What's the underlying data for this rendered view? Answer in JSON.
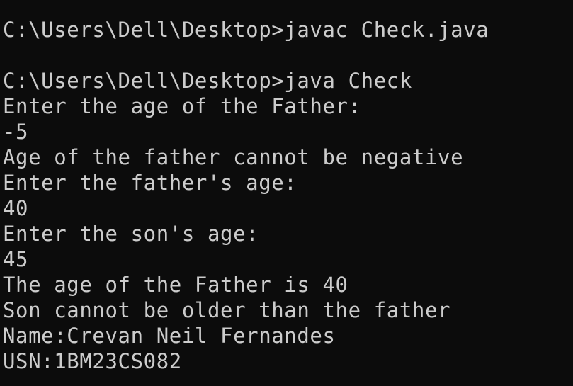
{
  "terminal": {
    "background": "#0c0c0c",
    "foreground": "#cccccc",
    "lines": [
      "C:\\Users\\Dell\\Desktop>javac Check.java",
      "",
      "C:\\Users\\Dell\\Desktop>java Check",
      "Enter the age of the Father:",
      "-5",
      "Age of the father cannot be negative",
      "Enter the father's age:",
      "40",
      "Enter the son's age:",
      "45",
      "The age of the Father is 40",
      "Son cannot be older than the father",
      "Name:Crevan Neil Fernandes",
      "USN:1BM23CS082"
    ]
  }
}
